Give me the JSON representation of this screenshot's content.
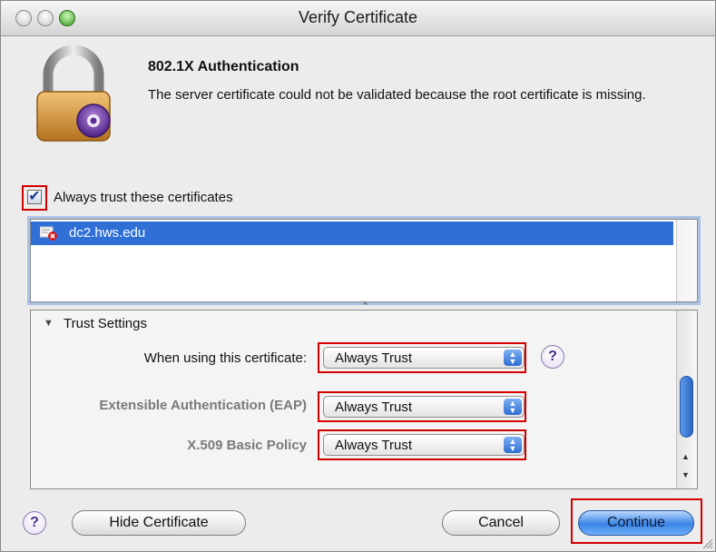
{
  "window": {
    "title": "Verify Certificate"
  },
  "header": {
    "heading": "802.1X Authentication",
    "message": "The server certificate could not be validated because the root certificate is missing."
  },
  "trust_checkbox": {
    "label": "Always trust these certificates",
    "checked": true,
    "check_glyph": "✔"
  },
  "certificate_list": {
    "items": [
      {
        "label": "dc2.hws.edu",
        "icon": "certificate-error-icon",
        "selected": true
      }
    ]
  },
  "trust_settings": {
    "section_label": "Trust Settings",
    "disclosure_glyph": "▼",
    "rows": [
      {
        "label": "When using this certificate:",
        "value": "Always Trust"
      },
      {
        "label": "Extensible Authentication (EAP)",
        "value": "Always Trust"
      },
      {
        "label": "X.509 Basic Policy",
        "value": "Always Trust"
      }
    ]
  },
  "buttons": {
    "help": "?",
    "hide_certificate": "Hide Certificate",
    "cancel": "Cancel",
    "continue": "Continue"
  },
  "colors": {
    "selection": "#2f6fd6",
    "highlight": "#d40000"
  }
}
